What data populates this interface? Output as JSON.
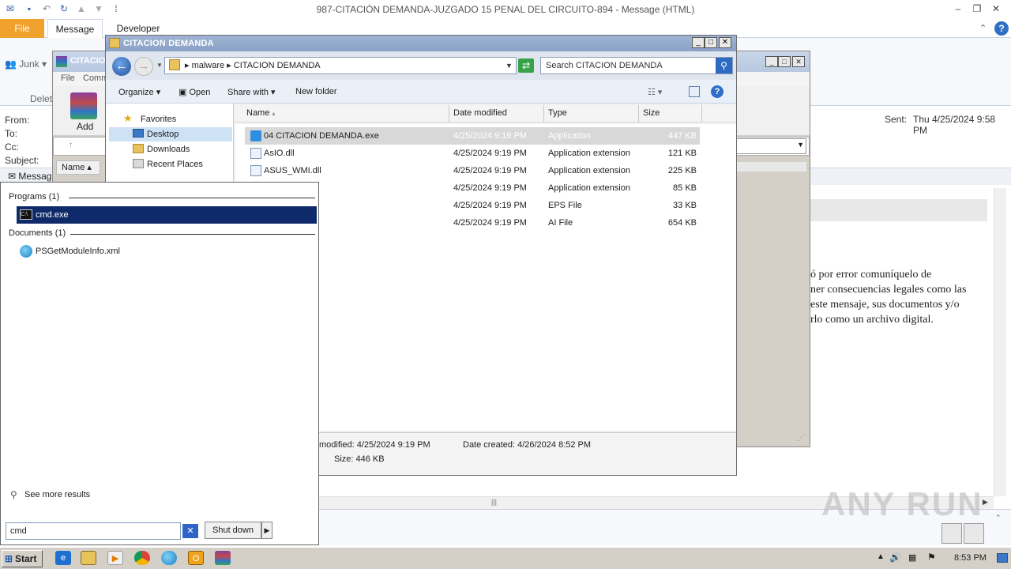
{
  "outlook": {
    "title": "987-CITACIÓN  DEMANDA-JUZGADO 15 PENAL DEL CIRCUITO-894 -  Message (HTML)",
    "tabs": [
      "File",
      "Message",
      "Developer"
    ],
    "junk_label": "Junk",
    "delete_group": "Delet",
    "header_labels": [
      "From:",
      "To:",
      "Cc:",
      "Subject:"
    ],
    "sent_label": "Sent:",
    "sent_value": "Thu 4/25/2024 9:58 PM",
    "message_tab": "Messag",
    "body_lines": [
      "ó por error comuníquelo de",
      "ner consecuencias legales como las",
      "este mensaje, sus documentos y/o",
      "rlo como un archivo digital."
    ]
  },
  "winrar": {
    "title": "CITACIO",
    "menu": [
      "File",
      "Comm"
    ],
    "add_label": "Add",
    "name_col": "Name"
  },
  "explorer": {
    "title": "CITACION DEMANDA",
    "address": [
      "malware",
      "CITACION DEMANDA"
    ],
    "search_placeholder": "Search CITACION DEMANDA",
    "commands": {
      "organize": "Organize",
      "open": "Open",
      "share": "Share with",
      "new_folder": "New folder"
    },
    "nav": {
      "favorites": "Favorites",
      "desktop": "Desktop",
      "downloads": "Downloads",
      "recent": "Recent Places"
    },
    "columns": {
      "name": "Name",
      "date": "Date modified",
      "type": "Type",
      "size": "Size"
    },
    "files": [
      {
        "name": "04 CITACION DEMANDA.exe",
        "date": "4/25/2024 9:19 PM",
        "type": "Application",
        "size": "447 KB"
      },
      {
        "name": "AsIO.dll",
        "date": "4/25/2024 9:19 PM",
        "type": "Application extension",
        "size": "121 KB"
      },
      {
        "name": "ASUS_WMI.dll",
        "date": "4/25/2024 9:19 PM",
        "type": "Application extension",
        "size": "225 KB"
      },
      {
        "name": "",
        "date": "4/25/2024 9:19 PM",
        "type": "Application extension",
        "size": "85 KB"
      },
      {
        "name": "",
        "date": "4/25/2024 9:19 PM",
        "type": "EPS File",
        "size": "33 KB"
      },
      {
        "name": "",
        "date": "4/25/2024 9:19 PM",
        "type": "AI File",
        "size": "654 KB"
      }
    ],
    "details": {
      "modified": "modified:  4/25/2024 9:19 PM",
      "created": "Date created:  4/26/2024 8:52 PM",
      "size": "Size:  446 KB"
    }
  },
  "start_menu": {
    "programs_header": "Programs (1)",
    "program_item": "cmd.exe",
    "documents_header": "Documents (1)",
    "document_item": "PSGetModuleInfo.xml",
    "see_more": "See more results",
    "search_value": "cmd",
    "shutdown": "Shut down"
  },
  "taskbar": {
    "start": "Start",
    "clock": "8:53 PM"
  },
  "watermark": "ANY RUN"
}
